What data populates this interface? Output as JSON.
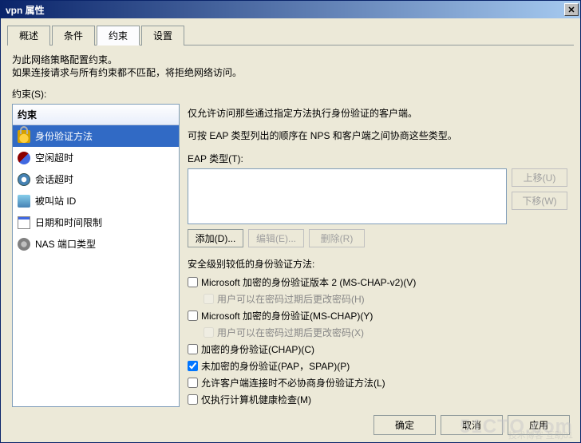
{
  "window": {
    "title": "vpn 属性"
  },
  "tabs": [
    "概述",
    "条件",
    "约束",
    "设置"
  ],
  "active_tab": 2,
  "description": {
    "line1": "为此网络策略配置约束。",
    "line2": "如果连接请求与所有约束都不匹配，将拒绝网络访问。"
  },
  "constraints_label": "约束(S):",
  "sidebar": {
    "header": "约束",
    "items": [
      {
        "icon": "lock",
        "label": "身份验证方法",
        "selected": true
      },
      {
        "icon": "clock1",
        "label": "空闲超时"
      },
      {
        "icon": "clock2",
        "label": "会话超时"
      },
      {
        "icon": "phone",
        "label": "被叫站 ID"
      },
      {
        "icon": "calendar",
        "label": "日期和时间限制"
      },
      {
        "icon": "nas",
        "label": "NAS 端口类型"
      }
    ]
  },
  "right": {
    "desc1": "仅允许访问那些通过指定方法执行身份验证的客户端。",
    "desc2": "可按 EAP 类型列出的顺序在 NPS 和客户端之间协商这些类型。",
    "eap_label": "EAP 类型(T):",
    "btn_up": "上移(U)",
    "btn_down": "下移(W)",
    "btn_add": "添加(D)...",
    "btn_edit": "编辑(E)...",
    "btn_remove": "删除(R)",
    "sec_label": "安全级别较低的身份验证方法:",
    "checks": [
      {
        "label": "Microsoft 加密的身份验证版本 2 (MS-CHAP-v2)(V)",
        "checked": false,
        "indent": false,
        "disabled": false
      },
      {
        "label": "用户可以在密码过期后更改密码(H)",
        "checked": false,
        "indent": true,
        "disabled": true
      },
      {
        "label": "Microsoft 加密的身份验证(MS-CHAP)(Y)",
        "checked": false,
        "indent": false,
        "disabled": false
      },
      {
        "label": "用户可以在密码过期后更改密码(X)",
        "checked": false,
        "indent": true,
        "disabled": true
      },
      {
        "label": "加密的身份验证(CHAP)(C)",
        "checked": false,
        "indent": false,
        "disabled": false
      },
      {
        "label": "未加密的身份验证(PAP，SPAP)(P)",
        "checked": true,
        "indent": false,
        "disabled": false
      },
      {
        "label": "允许客户端连接时不必协商身份验证方法(L)",
        "checked": false,
        "indent": false,
        "disabled": false
      },
      {
        "label": "仅执行计算机健康检查(M)",
        "checked": false,
        "indent": false,
        "disabled": false
      }
    ]
  },
  "buttons": {
    "ok": "确定",
    "cancel": "取消",
    "apply": "应用"
  },
  "watermark": {
    "main": "51CTO.com",
    "sub": "技术博客 互助01"
  }
}
